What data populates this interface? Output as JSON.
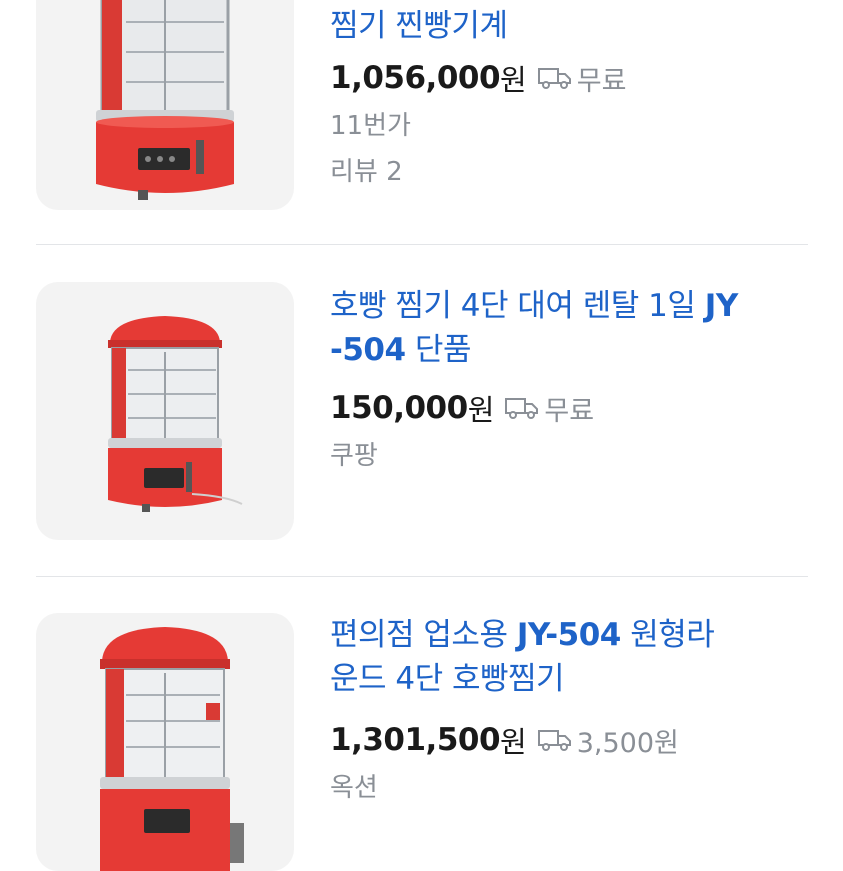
{
  "colors": {
    "title": "#1e63c8",
    "price": "#1a1a1a",
    "meta": "#8a8f96",
    "steamer_red": "#e53a35"
  },
  "items": [
    {
      "title_line1": "찜기 찐빵기계",
      "price": "1,056,000",
      "currency": "원",
      "shipping_icon": "truck-icon",
      "shipping": "무료",
      "seller": "11번가",
      "reviews": "리뷰 2"
    },
    {
      "title_part1": "호빵 찜기 4단 대여 렌탈 1일 ",
      "title_model_a": "JY",
      "title_model_b": "-504",
      "title_part2": " 단품",
      "price": "150,000",
      "currency": "원",
      "shipping_icon": "truck-icon",
      "shipping": "무료",
      "seller": "쿠팡"
    },
    {
      "title_part1": "편의점 업소용 ",
      "title_model": "JY-504",
      "title_part2": " 원형라",
      "title_line2": "운드 4단 호빵찜기",
      "price": "1,301,500",
      "currency": "원",
      "shipping_icon": "truck-icon",
      "shipping": "3,500원",
      "seller": "옥션"
    }
  ]
}
